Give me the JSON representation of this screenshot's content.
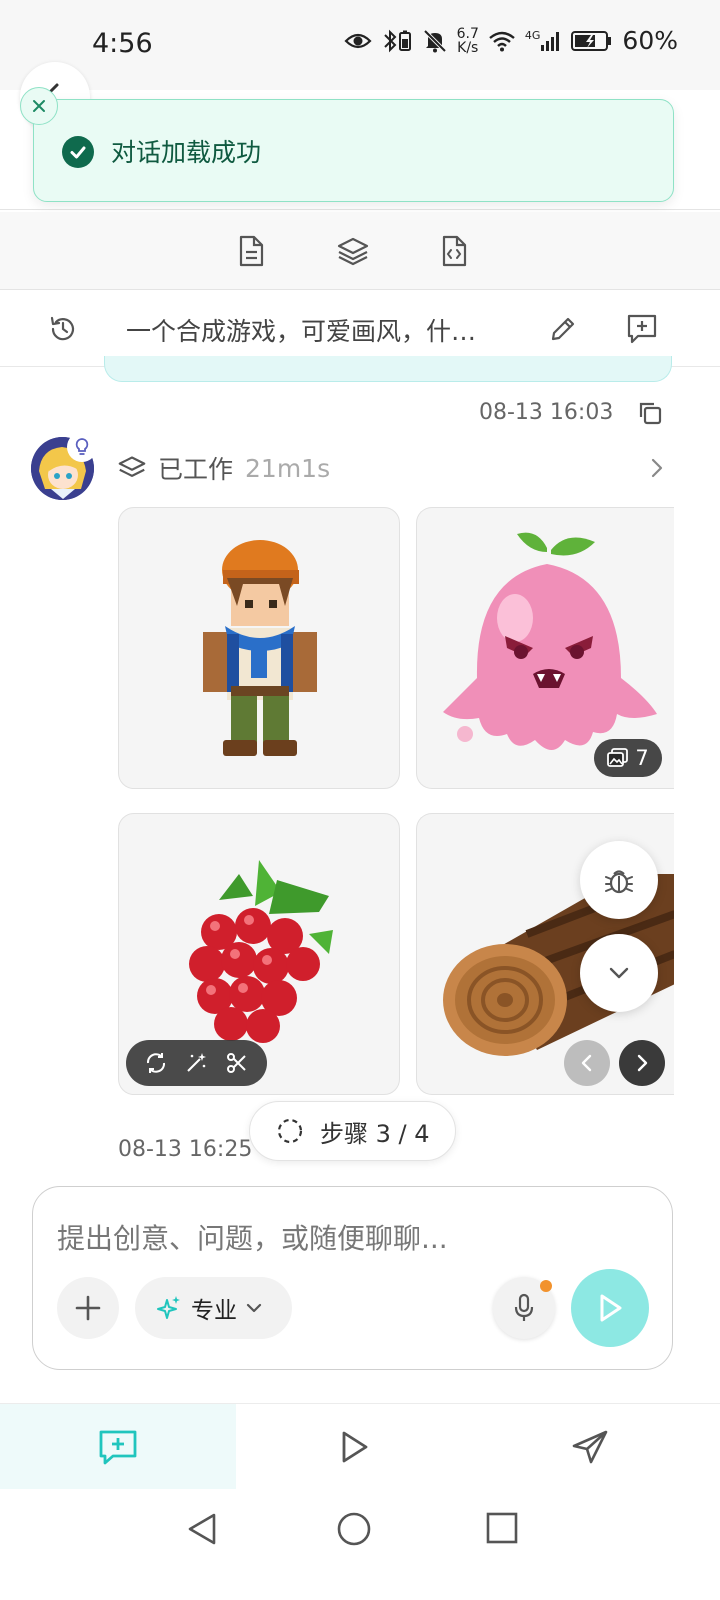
{
  "status_bar": {
    "time": "4:56",
    "net_speed_value": "6.7",
    "net_speed_unit": "K/s",
    "signal_label": "4G",
    "battery": "60%"
  },
  "toast": {
    "message": "对话加载成功",
    "accent": "#0f6a4d"
  },
  "toolbar": {
    "items": [
      "document-icon",
      "layers-icon",
      "code-file-icon"
    ]
  },
  "conversation": {
    "title": "一个合成游戏，可爱画风，什…"
  },
  "messages": {
    "first_timestamp": "08-13 16:03",
    "worked_label": "已工作",
    "worked_duration": "21m1s",
    "image_count": "7",
    "last_timestamp": "08-13 16:25"
  },
  "step": {
    "label": "步骤 3 / 4"
  },
  "composer": {
    "placeholder": "提出创意、问题，或随便聊聊...",
    "mode_label": "专业",
    "accent": "#20c5bd"
  },
  "bottom_tabs": [
    "chat-tab",
    "play-tab",
    "send-tab"
  ]
}
